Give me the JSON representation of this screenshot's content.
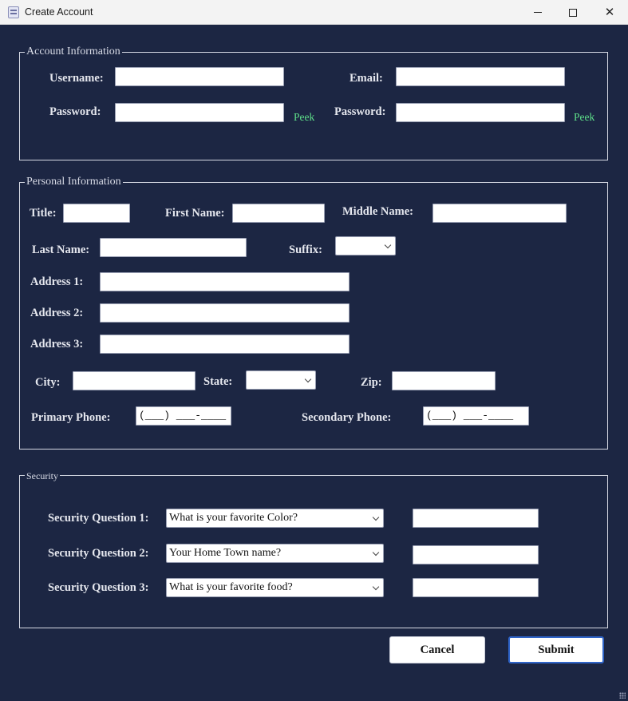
{
  "window": {
    "title": "Create Account"
  },
  "account": {
    "legend": "Account Information",
    "username_label": "Username:",
    "email_label": "Email:",
    "password_label": "Password:",
    "confirm_password_label": "Password:",
    "peek_label": "Peek",
    "username_value": "",
    "email_value": "",
    "password_value": "",
    "confirm_password_value": ""
  },
  "personal": {
    "legend": "Personal Information",
    "title_label": "Title:",
    "first_name_label": "First Name:",
    "middle_name_label": "Middle Name:",
    "last_name_label": "Last Name:",
    "suffix_label": "Suffix:",
    "suffix_value": "",
    "address1_label": "Address 1:",
    "address2_label": "Address 2:",
    "address3_label": "Address 3:",
    "city_label": "City:",
    "state_label": "State:",
    "state_value": "",
    "zip_label": "Zip:",
    "primary_phone_label": "Primary Phone:",
    "primary_phone_value": "(___) ___-____",
    "secondary_phone_label": "Secondary Phone:",
    "secondary_phone_value": "(___) ___-____"
  },
  "security": {
    "legend": "Security",
    "questions": [
      {
        "label": "Security Question 1:",
        "selected": "What is your favorite Color?",
        "answer": ""
      },
      {
        "label": "Security Question 2:",
        "selected": "Your Home Town name?",
        "answer": ""
      },
      {
        "label": "Security Question 3:",
        "selected": "What is your favorite food?",
        "answer": ""
      }
    ]
  },
  "actions": {
    "cancel_label": "Cancel",
    "submit_label": "Submit"
  },
  "icons": {
    "app": "app-form-icon",
    "minimize": "minimize-icon",
    "maximize": "maximize-icon",
    "close": "close-icon",
    "dropdown": "chevron-down-icon",
    "resize": "resize-grip-icon"
  }
}
